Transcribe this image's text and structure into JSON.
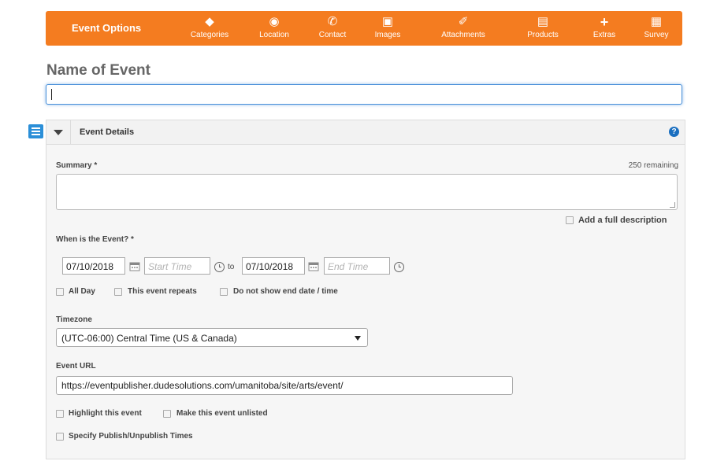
{
  "toolbar": {
    "title": "Event Options",
    "items": [
      {
        "label": "Categories",
        "icon": "tag-icon"
      },
      {
        "label": "Location",
        "icon": "map-marker-icon"
      },
      {
        "label": "Contact",
        "icon": "phone-icon"
      },
      {
        "label": "Images",
        "icon": "image-icon"
      },
      {
        "label": "Attachments",
        "icon": "paperclip-icon"
      },
      {
        "label": "Products",
        "icon": "shopping-cart-icon"
      },
      {
        "label": "Extras",
        "icon": "plus-icon"
      },
      {
        "label": "Survey",
        "icon": "document-icon"
      }
    ],
    "color": "#f47c20"
  },
  "form": {
    "name_label": "Name of Event",
    "name_value": ""
  },
  "panel": {
    "title": "Event Details",
    "summary_label": "Summary *",
    "remaining": "250 remaining",
    "summary_value": "",
    "full_description": "Add a full description",
    "when_label": "When is the Event? *",
    "start_date": "07/10/2018",
    "start_time_placeholder": "Start Time",
    "to_label": "to",
    "end_date": "07/10/2018",
    "end_time_placeholder": "End Time",
    "all_day": "All Day",
    "repeats": "This event repeats",
    "hide_end": "Do not show end date / time",
    "timezone_label": "Timezone",
    "timezone_value": "(UTC-06:00) Central Time (US & Canada)",
    "url_label": "Event URL",
    "url_value": "https://eventpublisher.dudesolutions.com/umanitoba/site/arts/event/",
    "highlight": "Highlight this event",
    "unlisted": "Make this event unlisted",
    "publish_times": "Specify Publish/Unpublish Times"
  }
}
